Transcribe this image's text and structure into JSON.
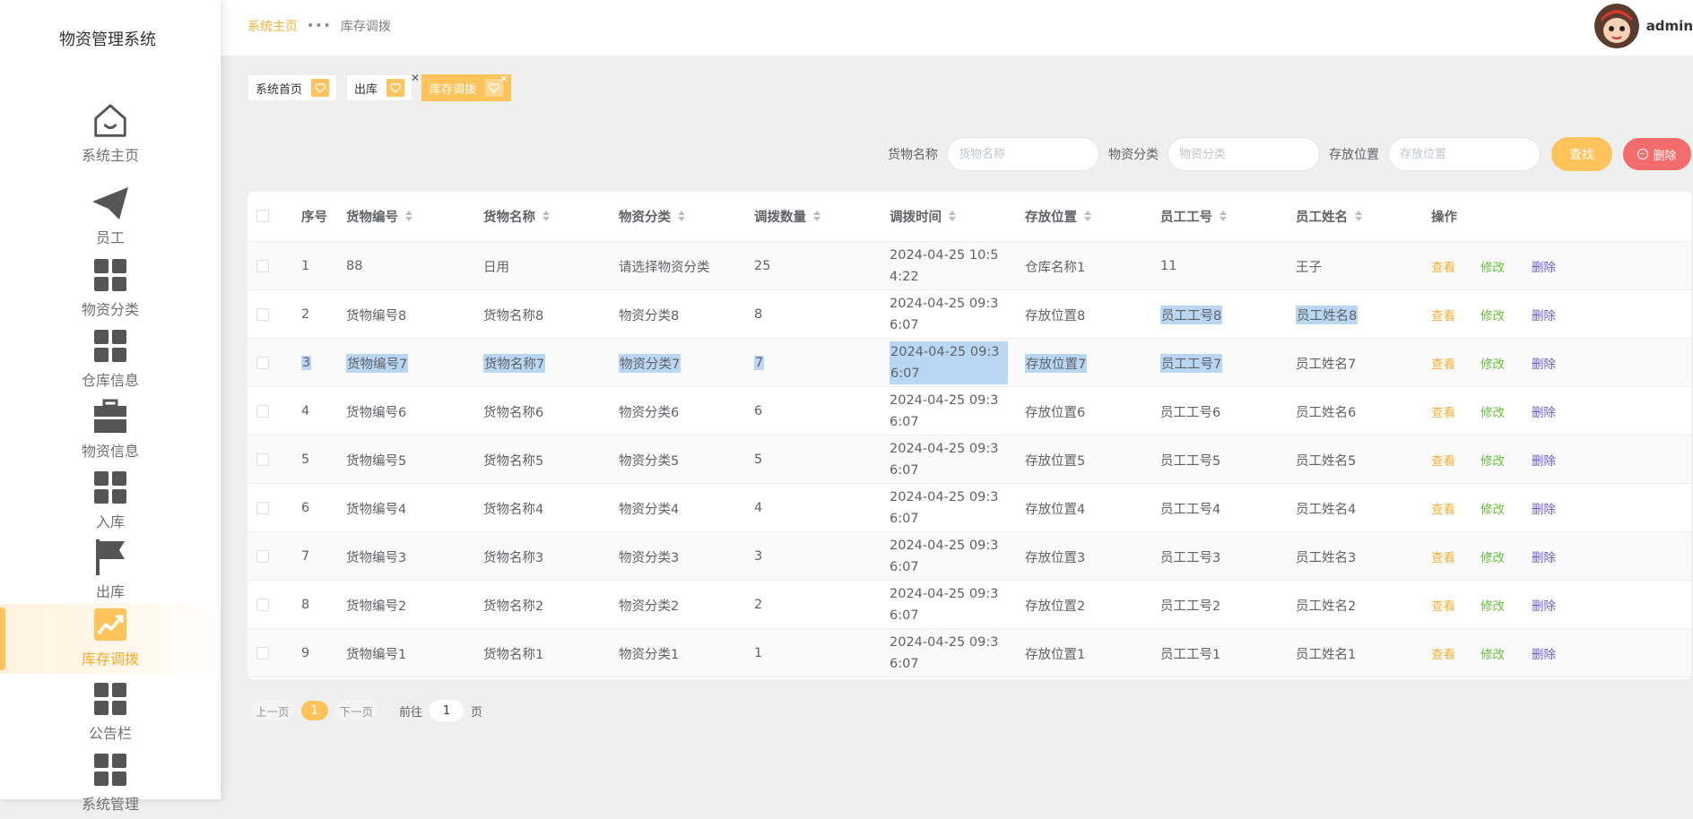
{
  "app": {
    "title": "物资管理系统"
  },
  "sidebar": {
    "items": [
      {
        "label": "系统主页",
        "icon": "home-icon"
      },
      {
        "label": "员工",
        "icon": "paper-plane-icon"
      },
      {
        "label": "物资分类",
        "icon": "grid-icon"
      },
      {
        "label": "仓库信息",
        "icon": "grid-icon"
      },
      {
        "label": "物资信息",
        "icon": "briefcase-icon"
      },
      {
        "label": "入库",
        "icon": "grid-icon"
      },
      {
        "label": "出库",
        "icon": "flag-icon"
      },
      {
        "label": "库存调拨",
        "icon": "trend-chart-icon",
        "active": true
      },
      {
        "label": "公告栏",
        "icon": "grid-icon"
      },
      {
        "label": "系统管理",
        "icon": "grid-icon"
      }
    ]
  },
  "header": {
    "breadcrumb_home": "系统主页",
    "breadcrumb_current": "库存调拨",
    "username": "admin"
  },
  "tags": [
    {
      "label": "系统首页"
    },
    {
      "label": "出库",
      "closable": true
    },
    {
      "label": "库存调拨",
      "closable": true,
      "active": true
    }
  ],
  "search": {
    "name_label": "货物名称",
    "name_placeholder": "货物名称",
    "category_label": "物资分类",
    "category_placeholder": "物资分类",
    "location_label": "存放位置",
    "location_placeholder": "存放位置",
    "find_label": "查找",
    "delete_label": "删除"
  },
  "table": {
    "headers": [
      "序号",
      "货物编号",
      "货物名称",
      "物资分类",
      "调拨数量",
      "调拨时间",
      "存放位置",
      "员工工号",
      "员工姓名",
      "操作"
    ],
    "actions": {
      "view": "查看",
      "edit": "修改",
      "delete": "删除"
    },
    "rows": [
      [
        "1",
        "88",
        "日用",
        "请选择物资分类",
        "25",
        "2024-04-25 10:54:22",
        "仓库名称1",
        "11",
        "王子"
      ],
      [
        "2",
        "货物编号8",
        "货物名称8",
        "物资分类8",
        "8",
        "2024-04-25 09:36:07",
        "存放位置8",
        "员工工号8",
        "员工姓名8"
      ],
      [
        "3",
        "货物编号7",
        "货物名称7",
        "物资分类7",
        "7",
        "2024-04-25 09:36:07",
        "存放位置7",
        "员工工号7",
        "员工姓名7"
      ],
      [
        "4",
        "货物编号6",
        "货物名称6",
        "物资分类6",
        "6",
        "2024-04-25 09:36:07",
        "存放位置6",
        "员工工号6",
        "员工姓名6"
      ],
      [
        "5",
        "货物编号5",
        "货物名称5",
        "物资分类5",
        "5",
        "2024-04-25 09:36:07",
        "存放位置5",
        "员工工号5",
        "员工姓名5"
      ],
      [
        "6",
        "货物编号4",
        "货物名称4",
        "物资分类4",
        "4",
        "2024-04-25 09:36:07",
        "存放位置4",
        "员工工号4",
        "员工姓名4"
      ],
      [
        "7",
        "货物编号3",
        "货物名称3",
        "物资分类3",
        "3",
        "2024-04-25 09:36:07",
        "存放位置3",
        "员工工号3",
        "员工姓名3"
      ],
      [
        "8",
        "货物编号2",
        "货物名称2",
        "物资分类2",
        "2",
        "2024-04-25 09:36:07",
        "存放位置2",
        "员工工号2",
        "员工姓名2"
      ],
      [
        "9",
        "货物编号1",
        "货物名称1",
        "物资分类1",
        "1",
        "2024-04-25 09:36:07",
        "存放位置1",
        "员工工号1",
        "员工姓名1"
      ]
    ]
  },
  "pager": {
    "prev": "上一页",
    "current": "1",
    "next": "下一页",
    "goto_label": "前往",
    "goto_value": "1",
    "page_unit": "页"
  },
  "colors": {
    "accent": "#ffc35c",
    "danger": "#f56c6c",
    "edit": "#67c23a",
    "delete_link": "#6b5cd6"
  }
}
